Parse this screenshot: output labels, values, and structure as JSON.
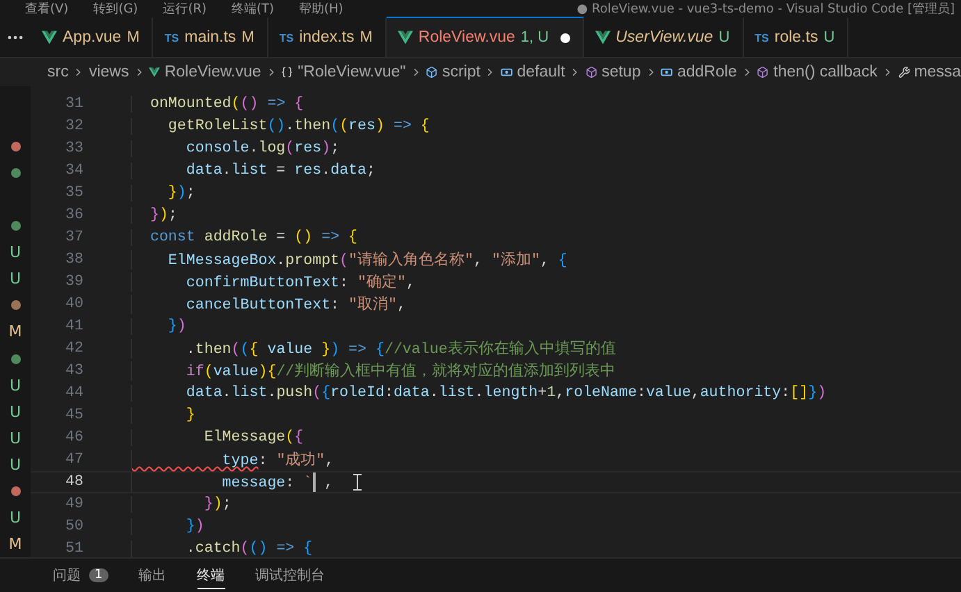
{
  "menu_bar": {
    "items": [
      "查看(V)",
      "转到(G)",
      "运行(R)",
      "终端(T)",
      "帮助(H)"
    ],
    "title": "● RoleView.vue - vue3-ts-demo - Visual Studio Code [管理员]"
  },
  "tabs": [
    {
      "kind": "vue",
      "label": "App.vue",
      "status": "M",
      "selected": false,
      "problem": false,
      "dirty": false,
      "preview": false
    },
    {
      "kind": "ts",
      "file_badge": "TS",
      "label": "main.ts",
      "status": "M",
      "selected": false,
      "problem": false,
      "dirty": false,
      "preview": false
    },
    {
      "kind": "ts",
      "file_badge": "TS",
      "label": "index.ts",
      "status": "M",
      "selected": false,
      "problem": false,
      "dirty": false,
      "preview": false
    },
    {
      "kind": "vue",
      "label": "RoleView.vue",
      "status": "1, U",
      "selected": true,
      "problem": true,
      "dirty": true,
      "preview": false
    },
    {
      "kind": "vue",
      "label": "UserView.vue",
      "status": "U",
      "selected": false,
      "problem": false,
      "dirty": false,
      "preview": true
    },
    {
      "kind": "ts",
      "file_badge": "TS",
      "label": "role.ts",
      "status": "U",
      "selected": false,
      "problem": false,
      "dirty": false,
      "preview": false
    }
  ],
  "breadcrumbs": [
    {
      "kind": "folder",
      "label": "src"
    },
    {
      "kind": "folder",
      "label": "views"
    },
    {
      "kind": "vue",
      "label": "RoleView.vue"
    },
    {
      "kind": "module",
      "label": "\"RoleView.vue\""
    },
    {
      "kind": "class",
      "label": "script"
    },
    {
      "kind": "field",
      "label": "default"
    },
    {
      "kind": "method",
      "label": "setup"
    },
    {
      "kind": "field",
      "label": "addRole"
    },
    {
      "kind": "method",
      "label": "then() callback"
    },
    {
      "kind": "property",
      "label": "messa"
    }
  ],
  "sidebar": {
    "decorations": [
      {
        "kind": "dot",
        "color": "#c3685d"
      },
      {
        "kind": "dot",
        "color": "#4f8a5f"
      },
      {
        "kind": "blank"
      },
      {
        "kind": "dot",
        "color": "#4f8a5f"
      },
      {
        "kind": "letter",
        "text": "U",
        "color": "#73c991"
      },
      {
        "kind": "letter",
        "text": "U",
        "color": "#73c991"
      },
      {
        "kind": "dot",
        "color": "#9a7255"
      },
      {
        "kind": "letter",
        "text": "M",
        "color": "#e2c08d"
      },
      {
        "kind": "dot",
        "color": "#4f8a5f"
      },
      {
        "kind": "letter",
        "text": "U",
        "color": "#73c991"
      },
      {
        "kind": "letter",
        "text": "U",
        "color": "#73c991"
      },
      {
        "kind": "letter",
        "text": "U",
        "color": "#73c991"
      },
      {
        "kind": "letter",
        "text": "U",
        "color": "#73c991"
      },
      {
        "kind": "dot",
        "color": "#c3685d"
      },
      {
        "kind": "letter",
        "text": "U",
        "color": "#73c991"
      },
      {
        "kind": "letter",
        "text": "M",
        "color": "#e2c08d"
      }
    ]
  },
  "editor": {
    "lines": [
      {
        "number": "31",
        "current": false,
        "tokens": [
          {
            "kind": "fn",
            "text": "  onMounted"
          },
          {
            "kind": "b1",
            "text": "("
          },
          {
            "kind": "b2",
            "text": "()"
          },
          {
            "kind": "kw",
            "text": " => "
          },
          {
            "kind": "b2",
            "text": "{"
          }
        ]
      },
      {
        "number": "32",
        "current": false,
        "tokens": [
          {
            "kind": "fn",
            "text": "    getRoleList"
          },
          {
            "kind": "b3",
            "text": "()"
          },
          {
            "kind": "p",
            "text": "."
          },
          {
            "kind": "fn",
            "text": "then"
          },
          {
            "kind": "b3",
            "text": "("
          },
          {
            "kind": "b1",
            "text": "("
          },
          {
            "kind": "var",
            "text": "res"
          },
          {
            "kind": "b1",
            "text": ")"
          },
          {
            "kind": "kw",
            "text": " => "
          },
          {
            "kind": "b1",
            "text": "{"
          }
        ]
      },
      {
        "number": "33",
        "current": false,
        "tokens": [
          {
            "kind": "var",
            "text": "      console"
          },
          {
            "kind": "p",
            "text": "."
          },
          {
            "kind": "fn",
            "text": "log"
          },
          {
            "kind": "b2",
            "text": "("
          },
          {
            "kind": "var",
            "text": "res"
          },
          {
            "kind": "b2",
            "text": ")"
          },
          {
            "kind": "p",
            "text": ";"
          }
        ]
      },
      {
        "number": "34",
        "current": false,
        "tokens": [
          {
            "kind": "var",
            "text": "      data"
          },
          {
            "kind": "p",
            "text": "."
          },
          {
            "kind": "var",
            "text": "list"
          },
          {
            "kind": "p",
            "text": " = "
          },
          {
            "kind": "var",
            "text": "res"
          },
          {
            "kind": "p",
            "text": "."
          },
          {
            "kind": "var",
            "text": "data"
          },
          {
            "kind": "p",
            "text": ";"
          }
        ]
      },
      {
        "number": "35",
        "current": false,
        "tokens": [
          {
            "kind": "b1",
            "text": "    }"
          },
          {
            "kind": "b3",
            "text": ")"
          },
          {
            "kind": "p",
            "text": ";"
          }
        ]
      },
      {
        "number": "36",
        "current": false,
        "tokens": [
          {
            "kind": "b2",
            "text": "  }"
          },
          {
            "kind": "b1",
            "text": ")"
          },
          {
            "kind": "p",
            "text": ";"
          }
        ]
      },
      {
        "number": "37",
        "current": false,
        "tokens": [
          {
            "kind": "kw",
            "text": "  const"
          },
          {
            "kind": "fn",
            "text": " addRole"
          },
          {
            "kind": "p",
            "text": " = "
          },
          {
            "kind": "b1",
            "text": "()"
          },
          {
            "kind": "kw",
            "text": " => "
          },
          {
            "kind": "b1",
            "text": "{"
          }
        ]
      },
      {
        "number": "38",
        "current": false,
        "tokens": [
          {
            "kind": "var",
            "text": "    ElMessageBox"
          },
          {
            "kind": "p",
            "text": "."
          },
          {
            "kind": "fn",
            "text": "prompt"
          },
          {
            "kind": "b2",
            "text": "("
          },
          {
            "kind": "str",
            "text": "\"请输入角色名称\""
          },
          {
            "kind": "p",
            "text": ", "
          },
          {
            "kind": "str",
            "text": "\"添加\""
          },
          {
            "kind": "p",
            "text": ", "
          },
          {
            "kind": "b3",
            "text": "{"
          }
        ]
      },
      {
        "number": "39",
        "current": false,
        "tokens": [
          {
            "kind": "var",
            "text": "      confirmButtonText"
          },
          {
            "kind": "p",
            "text": ": "
          },
          {
            "kind": "str",
            "text": "\"确定\""
          },
          {
            "kind": "p",
            "text": ","
          }
        ]
      },
      {
        "number": "40",
        "current": false,
        "tokens": [
          {
            "kind": "var",
            "text": "      cancelButtonText"
          },
          {
            "kind": "p",
            "text": ": "
          },
          {
            "kind": "str",
            "text": "\"取消\""
          },
          {
            "kind": "p",
            "text": ","
          }
        ]
      },
      {
        "number": "41",
        "current": false,
        "tokens": [
          {
            "kind": "b3",
            "text": "    }"
          },
          {
            "kind": "b2",
            "text": ")"
          }
        ]
      },
      {
        "number": "42",
        "current": false,
        "tokens": [
          {
            "kind": "p",
            "text": "      ."
          },
          {
            "kind": "fn",
            "text": "then"
          },
          {
            "kind": "b2",
            "text": "("
          },
          {
            "kind": "b3",
            "text": "("
          },
          {
            "kind": "b1",
            "text": "{"
          },
          {
            "kind": "var",
            "text": " value "
          },
          {
            "kind": "b1",
            "text": "}"
          },
          {
            "kind": "b3",
            "text": ")"
          },
          {
            "kind": "kw",
            "text": " => "
          },
          {
            "kind": "b3",
            "text": "{"
          },
          {
            "kind": "cm",
            "text": "//value表示你在输入中填写的值"
          }
        ]
      },
      {
        "number": "43",
        "current": false,
        "tokens": [
          {
            "kind": "ctrl",
            "text": "      if"
          },
          {
            "kind": "b1",
            "text": "("
          },
          {
            "kind": "var",
            "text": "value"
          },
          {
            "kind": "b1",
            "text": ")"
          },
          {
            "kind": "b1",
            "text": "{"
          },
          {
            "kind": "cm",
            "text": "//判断输入框中有值，就将对应的值添加到列表中"
          }
        ]
      },
      {
        "number": "44",
        "current": false,
        "tokens": [
          {
            "kind": "var",
            "text": "      data"
          },
          {
            "kind": "p",
            "text": "."
          },
          {
            "kind": "var",
            "text": "list"
          },
          {
            "kind": "p",
            "text": "."
          },
          {
            "kind": "fn",
            "text": "push"
          },
          {
            "kind": "b2",
            "text": "("
          },
          {
            "kind": "b3",
            "text": "{"
          },
          {
            "kind": "var",
            "text": "roleId"
          },
          {
            "kind": "p",
            "text": ":"
          },
          {
            "kind": "var",
            "text": "data"
          },
          {
            "kind": "p",
            "text": "."
          },
          {
            "kind": "var",
            "text": "list"
          },
          {
            "kind": "p",
            "text": "."
          },
          {
            "kind": "var",
            "text": "length"
          },
          {
            "kind": "p",
            "text": "+"
          },
          {
            "kind": "num",
            "text": "1"
          },
          {
            "kind": "p",
            "text": ","
          },
          {
            "kind": "var",
            "text": "roleName"
          },
          {
            "kind": "p",
            "text": ":"
          },
          {
            "kind": "var",
            "text": "value"
          },
          {
            "kind": "p",
            "text": ","
          },
          {
            "kind": "var",
            "text": "authority"
          },
          {
            "kind": "p",
            "text": ":"
          },
          {
            "kind": "b1",
            "text": "[]"
          },
          {
            "kind": "b3",
            "text": "}"
          },
          {
            "kind": "b2",
            "text": ")"
          }
        ]
      },
      {
        "number": "45",
        "current": false,
        "tokens": [
          {
            "kind": "b1",
            "text": "      }"
          }
        ]
      },
      {
        "number": "46",
        "current": false,
        "tokens": [
          {
            "kind": "fn",
            "text": "        ElMessage"
          },
          {
            "kind": "b1",
            "text": "("
          },
          {
            "kind": "b2",
            "text": "{"
          }
        ]
      },
      {
        "number": "47",
        "current": false,
        "tokens": [
          {
            "kind": "err",
            "text": "          type"
          },
          {
            "kind": "p",
            "text": ": "
          },
          {
            "kind": "str",
            "text": "\"成功\""
          },
          {
            "kind": "p",
            "text": ","
          }
        ]
      },
      {
        "number": "48",
        "current": true,
        "tokens": [
          {
            "kind": "var",
            "text": "          message"
          },
          {
            "kind": "p",
            "text": ": "
          },
          {
            "kind": "str",
            "text": "`"
          }
        ],
        "after_cursor": [
          {
            "kind": "p",
            "text": " ,"
          }
        ]
      },
      {
        "number": "49",
        "current": false,
        "tokens": [
          {
            "kind": "b2",
            "text": "        }"
          },
          {
            "kind": "b1",
            "text": ")"
          },
          {
            "kind": "p",
            "text": ";"
          }
        ]
      },
      {
        "number": "50",
        "current": false,
        "tokens": [
          {
            "kind": "b3",
            "text": "      }"
          },
          {
            "kind": "b2",
            "text": ")"
          }
        ]
      },
      {
        "number": "51",
        "current": false,
        "tokens": [
          {
            "kind": "p",
            "text": "      ."
          },
          {
            "kind": "fn",
            "text": "catch"
          },
          {
            "kind": "b2",
            "text": "("
          },
          {
            "kind": "b3",
            "text": "()"
          },
          {
            "kind": "kw",
            "text": " => "
          },
          {
            "kind": "b3",
            "text": "{"
          }
        ]
      }
    ]
  },
  "panel": {
    "tabs": [
      {
        "label": "问题",
        "badge": "1",
        "selected": false
      },
      {
        "label": "输出",
        "selected": false
      },
      {
        "label": "终端",
        "selected": true
      },
      {
        "label": "调试控制台",
        "selected": false
      }
    ]
  }
}
